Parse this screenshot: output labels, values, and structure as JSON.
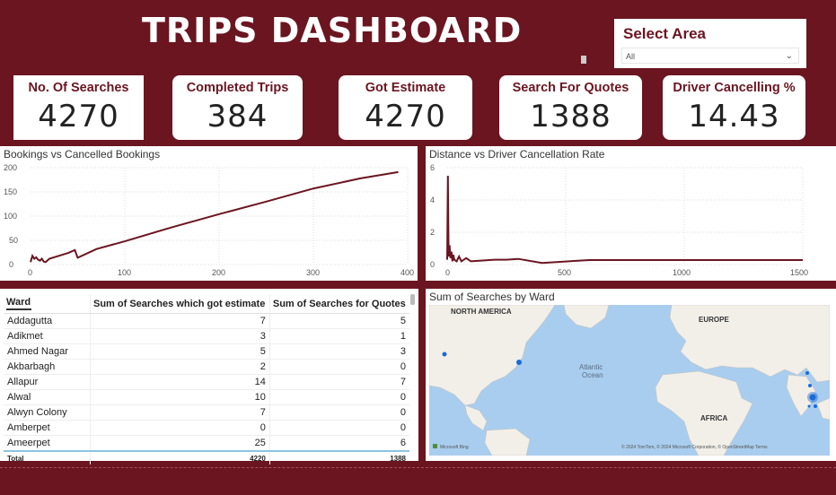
{
  "title": "TRIPS DASHBOARD",
  "slicer": {
    "label": "Select Area",
    "value": "All"
  },
  "kpis": [
    {
      "label": "No. Of Searches",
      "value": "4270"
    },
    {
      "label": "Completed Trips",
      "value": "384"
    },
    {
      "label": "Got Estimate",
      "value": "4270"
    },
    {
      "label": "Search For Quotes",
      "value": "1388"
    },
    {
      "label": "Driver Cancelling %",
      "value": "14.43"
    }
  ],
  "bookings_chart": {
    "title": "Bookings vs Cancelled Bookings",
    "y_ticks": [
      "200",
      "150",
      "100",
      "50",
      "0"
    ],
    "x_ticks": [
      "0",
      "100",
      "200",
      "300",
      "400"
    ]
  },
  "distance_chart": {
    "title": "Distance vs Driver Cancellation Rate",
    "y_ticks": [
      "6",
      "4",
      "2",
      "0"
    ],
    "x_ticks": [
      "0",
      "500",
      "1000",
      "1500"
    ]
  },
  "table": {
    "headers": [
      "Ward",
      "Sum of Searches which got estimate",
      "Sum of Searches for Quotes"
    ],
    "rows": [
      [
        "Addagutta",
        "7",
        "5"
      ],
      [
        "Adikmet",
        "3",
        "1"
      ],
      [
        "Ahmed Nagar",
        "5",
        "3"
      ],
      [
        "Akbarbagh",
        "2",
        "0"
      ],
      [
        "Allapur",
        "14",
        "7"
      ],
      [
        "Alwal",
        "10",
        "0"
      ],
      [
        "Alwyn Colony",
        "7",
        "0"
      ],
      [
        "Amberpet",
        "0",
        "0"
      ],
      [
        "Ameerpet",
        "25",
        "6"
      ]
    ],
    "total": [
      "Total",
      "4220",
      "1388"
    ]
  },
  "map": {
    "title": "Sum of Searches by Ward",
    "labels": {
      "na": "NORTH AMERICA",
      "europe": "EUROPE",
      "ocean1": "Atlantic",
      "ocean2": "Ocean",
      "africa": "AFRICA",
      "bing": "Microsoft Bing",
      "credit": "© 2024 TomTom, © 2024 Microsoft Corporation, © OpenStreetMap  Terms"
    }
  },
  "chart_data": [
    {
      "type": "line",
      "title": "Bookings vs Cancelled Bookings",
      "x": [
        0,
        2,
        4,
        6,
        8,
        10,
        12,
        14,
        16,
        20,
        30,
        40,
        47,
        50,
        70,
        100,
        150,
        200,
        250,
        300,
        350,
        390
      ],
      "y": [
        5,
        18,
        12,
        15,
        10,
        8,
        12,
        6,
        5,
        12,
        18,
        24,
        30,
        14,
        32,
        48,
        77,
        104,
        130,
        157,
        178,
        191
      ],
      "xlim": [
        0,
        400
      ],
      "ylim": [
        0,
        200
      ],
      "color": "#6b1520"
    },
    {
      "type": "line",
      "title": "Distance vs Driver Cancellation Rate",
      "x": [
        0,
        3,
        6,
        10,
        14,
        18,
        22,
        26,
        30,
        40,
        50,
        60,
        80,
        100,
        150,
        200,
        250,
        300,
        400,
        600,
        800,
        1000,
        1200,
        1500
      ],
      "y": [
        0.3,
        5.5,
        0.5,
        1.2,
        0.4,
        0.8,
        0.2,
        0.6,
        0.3,
        0.2,
        0.5,
        0.2,
        0.4,
        0.2,
        0.25,
        0.3,
        0.3,
        0.35,
        0.1,
        0.28,
        0.28,
        0.28,
        0.28,
        0.28
      ],
      "xlim": [
        0,
        1500
      ],
      "ylim": [
        0,
        6
      ],
      "color": "#6b1520"
    }
  ]
}
